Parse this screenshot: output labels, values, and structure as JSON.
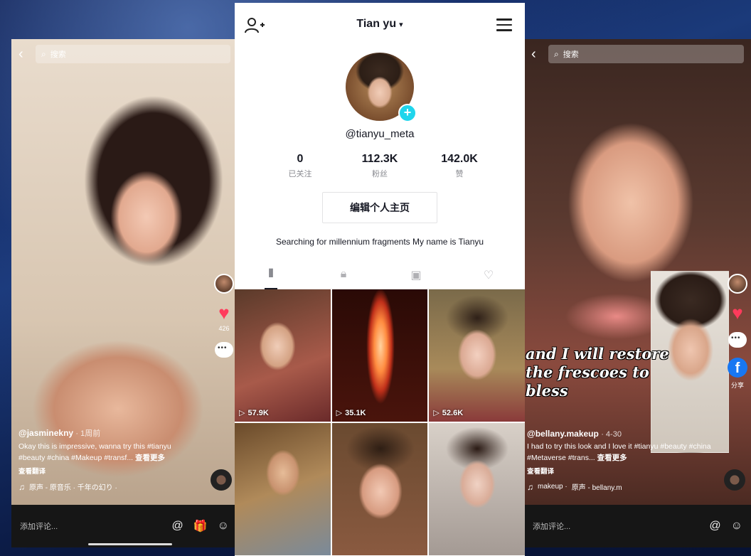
{
  "left_video": {
    "search_placeholder": "搜索",
    "username": "@jasminekny",
    "time": "· 1周前",
    "caption": "Okay this is impressive, wanna try this #tianyu #beauty #china #Makeup #transf...",
    "more": "查看更多",
    "translate": "查看翻译",
    "music": "原声 - 原音乐 · 千年の幻り · ",
    "comment_placeholder": "添加评论...",
    "at_icon": "@",
    "gift_icon": "🎁",
    "emoji_icon": "☺",
    "like_count": "426"
  },
  "profile": {
    "title": "Tian yu",
    "handle": "@tianyu_meta",
    "stats": [
      {
        "num": "0",
        "label": "已关注"
      },
      {
        "num": "112.3K",
        "label": "粉丝"
      },
      {
        "num": "142.0K",
        "label": "赞"
      }
    ],
    "edit_button": "编辑个人主页",
    "bio": "Searching for millennium fragments My name is Tianyu",
    "tabs": [
      {
        "icon": "grid-icon",
        "glyph": "⦀"
      },
      {
        "icon": "lock-icon",
        "glyph": "🔒︎"
      },
      {
        "icon": "tagged-icon",
        "glyph": "▣"
      },
      {
        "icon": "liked-icon",
        "glyph": "♡"
      }
    ],
    "videos": [
      {
        "views": "57.9K"
      },
      {
        "views": "35.1K"
      },
      {
        "views": "52.6K"
      },
      {
        "views": ""
      },
      {
        "views": ""
      },
      {
        "views": ""
      }
    ],
    "accent": "#20d5ec"
  },
  "right_video": {
    "search_placeholder": "搜索",
    "overlay_line1": "and I will restore",
    "overlay_line2": "the frescoes to bless",
    "username": "@bellany.makeup",
    "time": "· 4-30",
    "caption": "I had to try this look and I love it #tianyu #beauty #china #Metaverse #trans...",
    "more": "查看更多",
    "translate": "查看翻译",
    "music": "原声 - bellany.m",
    "music_prefix": "makeup · ",
    "comment_placeholder": "添加评论...",
    "at_icon": "@",
    "emoji_icon": "☺",
    "share_label": "分享"
  }
}
